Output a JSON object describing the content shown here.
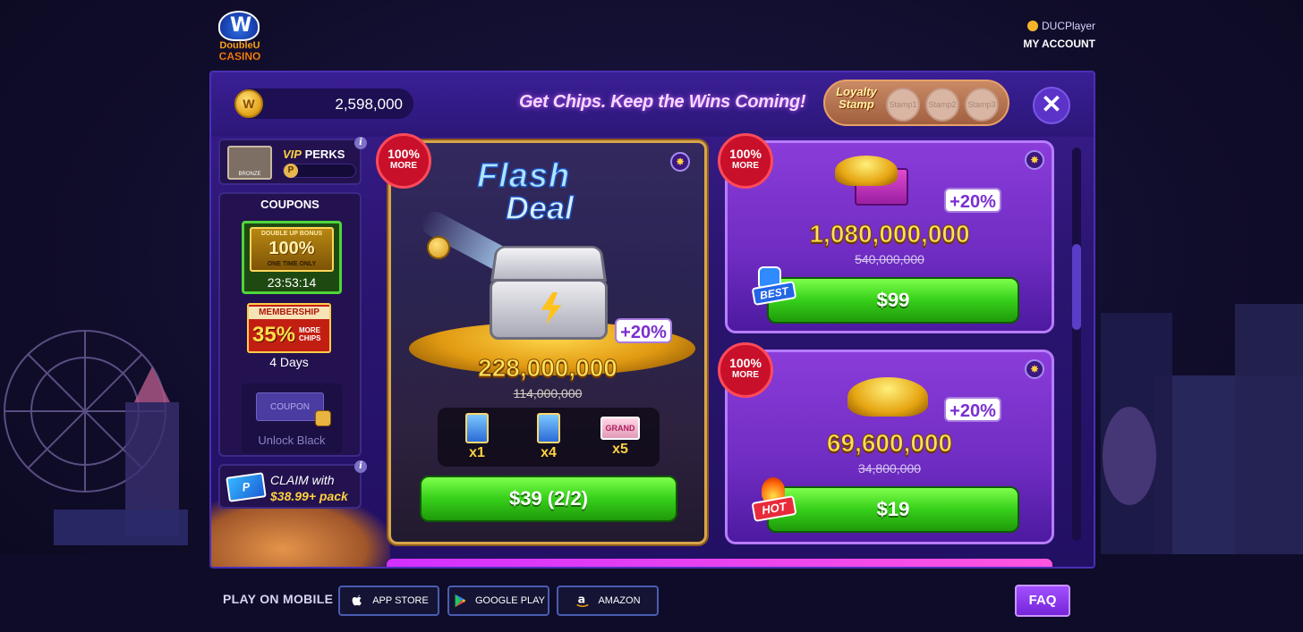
{
  "brand": {
    "logo_line1": "DoubleU",
    "logo_line2": "CASINO",
    "logo_letter": "W"
  },
  "account": {
    "username": "DUCPlayer",
    "my_account_label": "MY ACCOUNT"
  },
  "shop": {
    "balance": "2,598,000",
    "balance_coin_letter": "W",
    "headline": "Get Chips. Keep the Wins Coming!",
    "loyalty": {
      "label": "Loyalty Stamp",
      "stamps": [
        "Stamp1",
        "Stamp2",
        "Stamp3"
      ]
    },
    "close_label": "✕"
  },
  "sidebar": {
    "vip": {
      "badge_label": "BRONZE",
      "title_vip": "VIP",
      "title_perks": "PERKS",
      "points_icon": "P"
    },
    "coupons": {
      "title": "COUPONS",
      "double_up": {
        "top": "DOUBLE UP BONUS",
        "value": "100%",
        "bottom": "ONE TIME ONLY",
        "timer": "23:53:14"
      },
      "membership": {
        "top": "MEMBERSHIP",
        "value": "35%",
        "more": "MORE CHIPS",
        "days": "4 Days"
      },
      "locked": {
        "ticket": "COUPON",
        "label": "Unlock Black"
      }
    },
    "claim": {
      "icon_letter": "P",
      "line1": "CLAIM with",
      "line2": "$38.99+ pack"
    }
  },
  "flash_deal": {
    "title_line1": "Flash",
    "title_line2": "Deal",
    "badge_pct": "100%",
    "badge_more": "MORE",
    "bonus": "+20%",
    "amount": "228,000,000",
    "old_amount": "114,000,000",
    "items": [
      {
        "count": "x1"
      },
      {
        "count": "x4"
      },
      {
        "count": "x5",
        "label": "GRAND"
      }
    ],
    "price": "$39 (2/2)"
  },
  "offers": [
    {
      "badge_pct": "100%",
      "badge_more": "MORE",
      "bonus": "+20%",
      "amount": "1,080,000,000",
      "old_amount": "540,000,000",
      "tag": "BEST",
      "price": "$99"
    },
    {
      "badge_pct": "100%",
      "badge_more": "MORE",
      "bonus": "+20%",
      "amount": "69,600,000",
      "old_amount": "34,800,000",
      "tag": "HOT",
      "price": "$19"
    }
  ],
  "footer": {
    "play_label": "PLAY ON MOBILE",
    "stores": [
      "APP STORE",
      "GOOGLE PLAY",
      "AMAZON"
    ],
    "faq": "FAQ"
  },
  "icons": {
    "apple": "apple-icon",
    "google_play": "google-play-icon",
    "amazon": "amazon-icon",
    "info": "info-icon",
    "close": "close-icon"
  },
  "colors": {
    "panel": "#2a1570",
    "offer": "#7a34cc",
    "button_green": "#36cf1a",
    "gold_text": "#ffe25a",
    "faq": "#8a3cf0"
  }
}
